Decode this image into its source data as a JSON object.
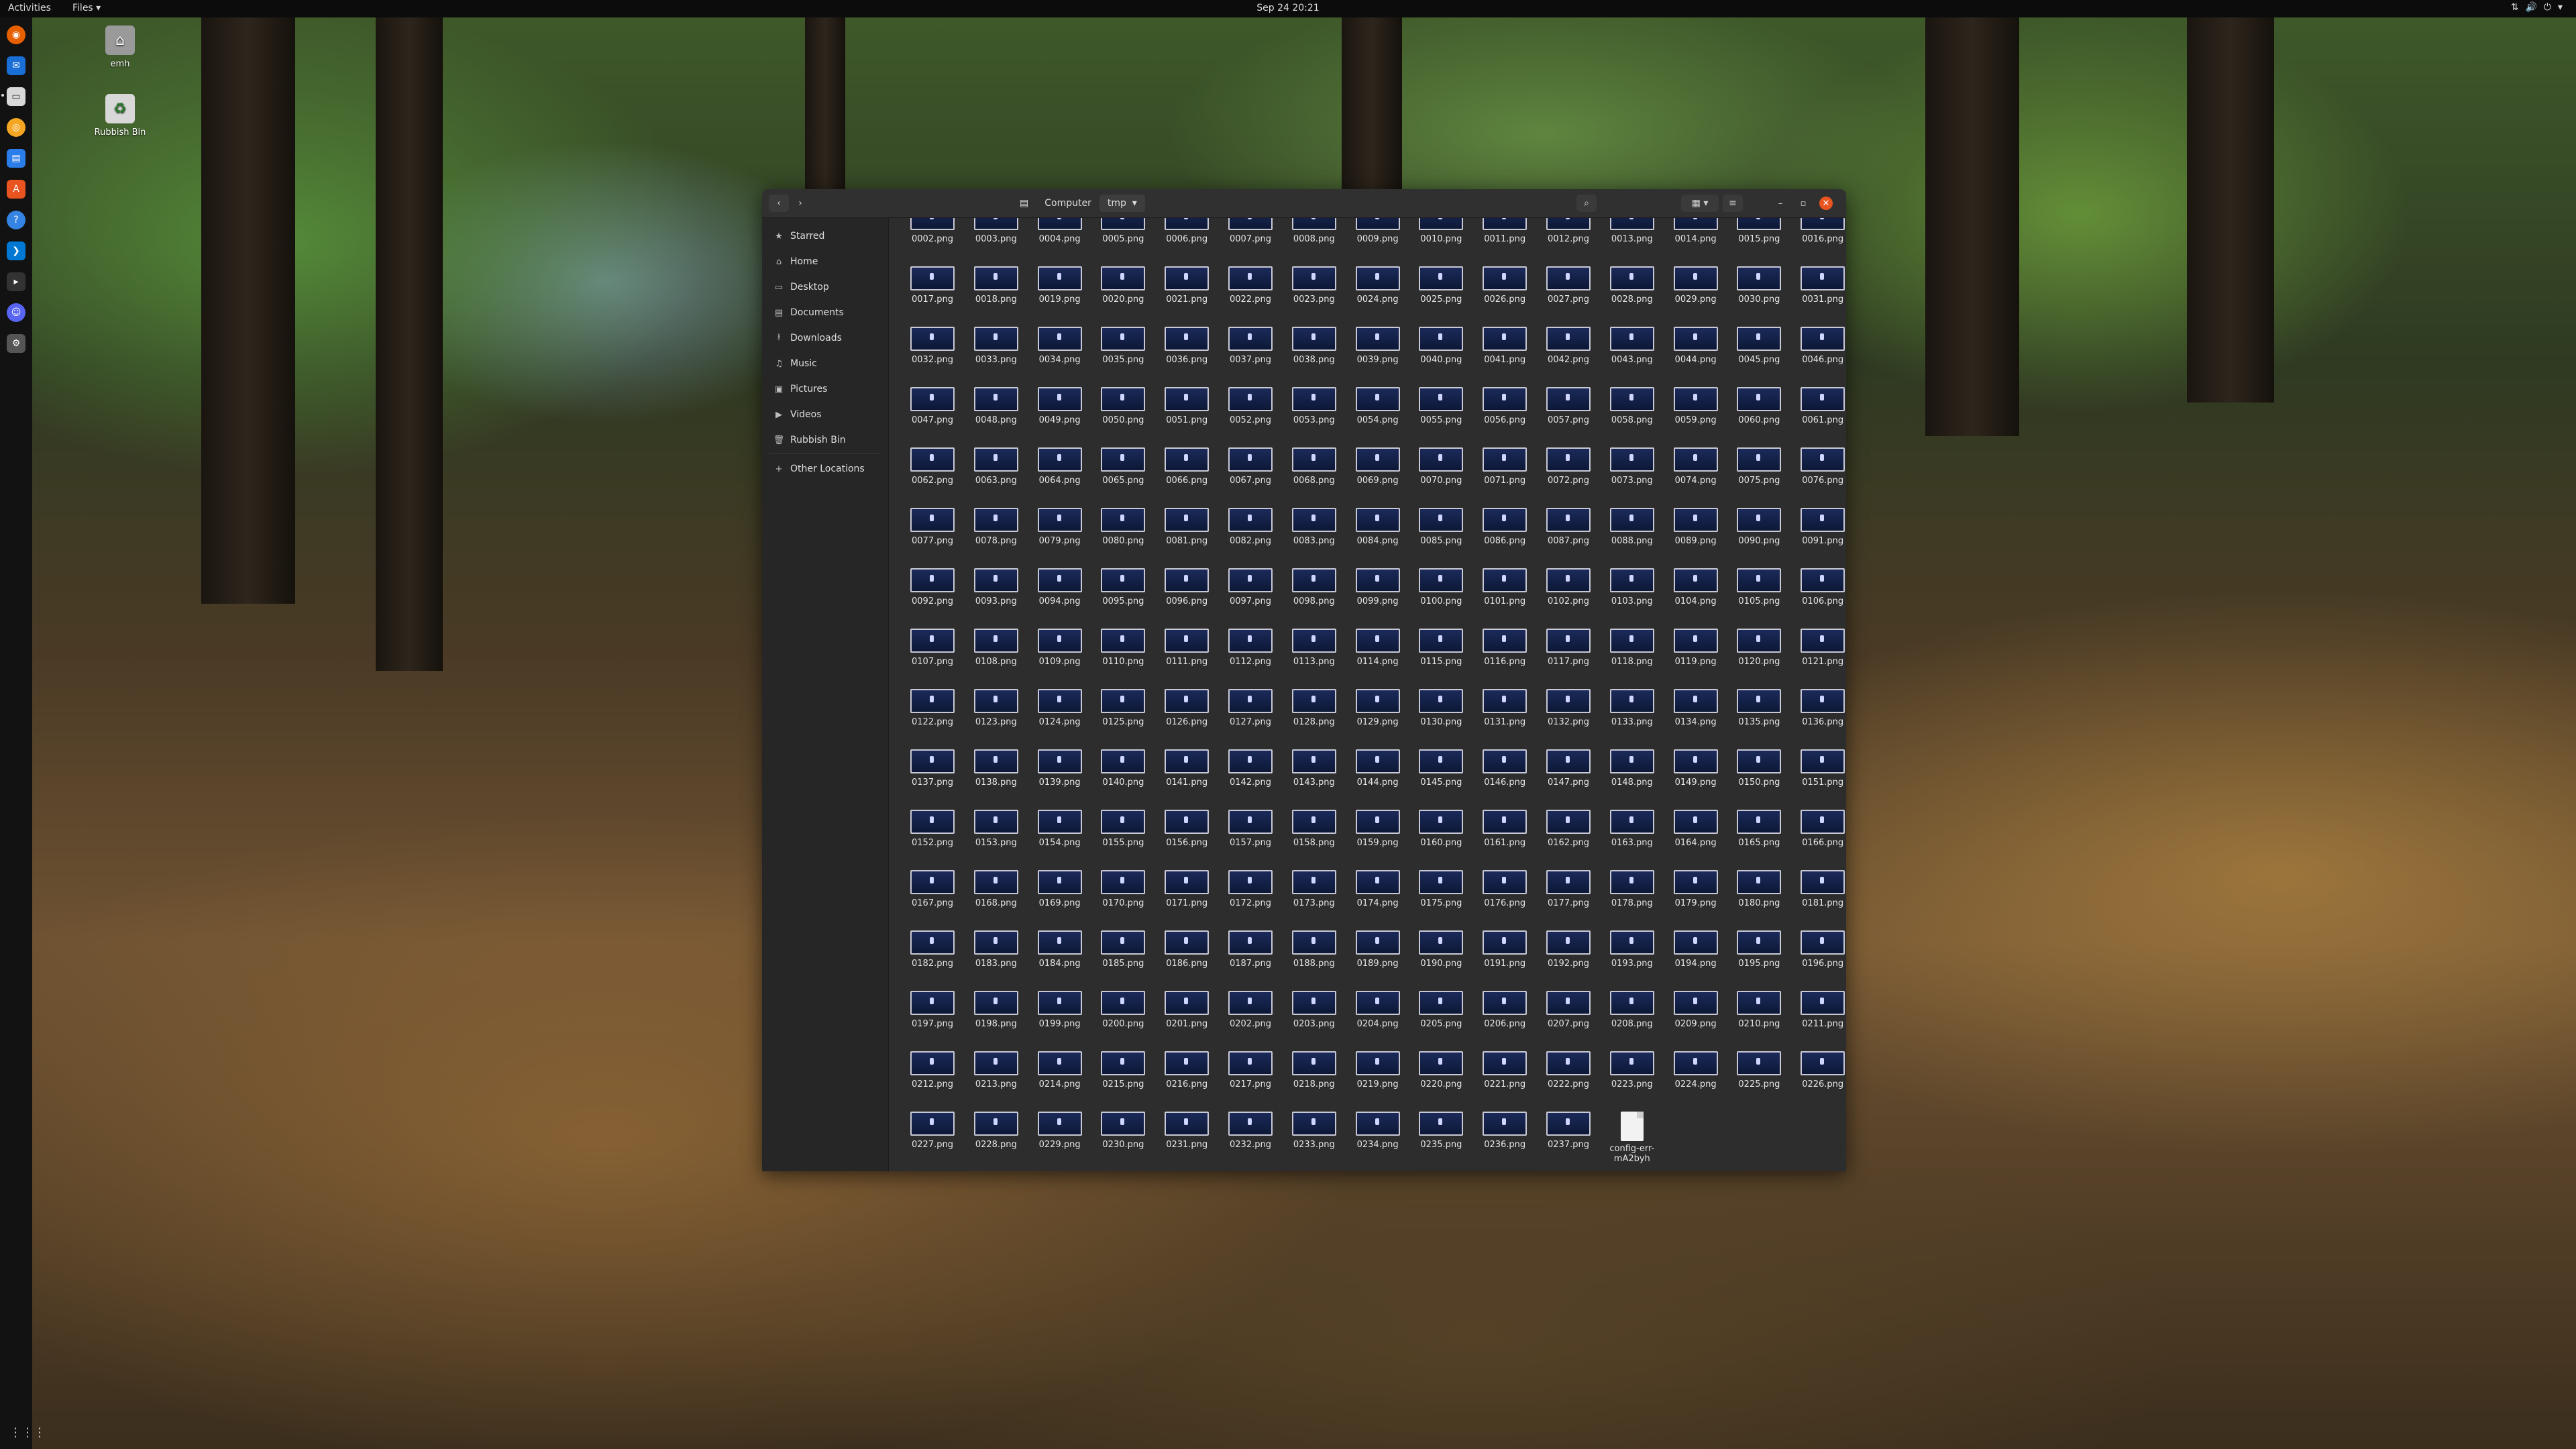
{
  "topbar": {
    "activities": "Activities",
    "app_menu": "Files ▾",
    "clock": "Sep 24  20:21",
    "tray_icons": [
      "network-icon",
      "volume-icon",
      "power-icon",
      "chevron-down-icon"
    ]
  },
  "dock": {
    "items": [
      "firefox-icon",
      "thunderbird-icon",
      "files-icon",
      "rhythmbox-icon",
      "libreoffice-writer-icon",
      "software-center-icon",
      "help-icon",
      "vscode-icon",
      "terminal-icon",
      "discord-icon",
      "settings-icon"
    ],
    "show_apps": "⋮⋮⋮"
  },
  "desktop": {
    "icons": [
      {
        "label": "emh",
        "icon": "home-folder-icon"
      },
      {
        "label": "Rubbish Bin",
        "icon": "trash-icon"
      }
    ]
  },
  "window": {
    "path": [
      "Computer",
      "tmp"
    ],
    "sidebar": [
      {
        "label": "Starred",
        "icon": "★"
      },
      {
        "label": "Home",
        "icon": "⌂"
      },
      {
        "label": "Desktop",
        "icon": "▭"
      },
      {
        "label": "Documents",
        "icon": "▤"
      },
      {
        "label": "Downloads",
        "icon": "⭳"
      },
      {
        "label": "Music",
        "icon": "♫"
      },
      {
        "label": "Pictures",
        "icon": "▣"
      },
      {
        "label": "Videos",
        "icon": "▶"
      },
      {
        "label": "Rubbish Bin",
        "icon": "🗑"
      },
      {
        "label": "Other Locations",
        "icon": "+"
      }
    ],
    "files_start": 2,
    "files_end": 237,
    "extra_file": "config-err-mA2byh"
  }
}
